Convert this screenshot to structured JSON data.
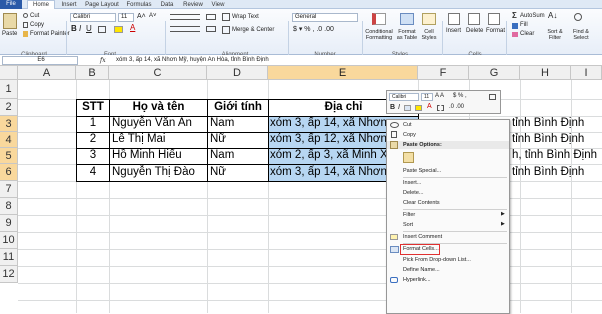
{
  "tabs": [
    "File",
    "Home",
    "Insert",
    "Page Layout",
    "Formulas",
    "Data",
    "Review",
    "View"
  ],
  "clipboard": {
    "cut": "Cut",
    "copy": "Copy",
    "format_painter": "Format Painter",
    "paste": "Paste",
    "group": "Clipboard"
  },
  "font": {
    "name": "Calibri",
    "size": "11",
    "group": "Font"
  },
  "alignment": {
    "wrap": "Wrap Text",
    "merge": "Merge & Center",
    "group": "Alignment"
  },
  "number": {
    "format": "General",
    "group": "Number"
  },
  "styles": {
    "cond": "Conditional Formatting",
    "fmt_table": "Format as Table",
    "cell_styles": "Cell Styles",
    "group": "Styles"
  },
  "cells": {
    "insert": "Insert",
    "delete": "Delete",
    "format": "Format",
    "group": "Cells"
  },
  "editing": {
    "autosum": "AutoSum",
    "fill": "Fill",
    "clear": "Clear",
    "sort": "Sort & Filter",
    "find": "Find & Select"
  },
  "formula_bar": {
    "name_box": "E6",
    "fx": "fx",
    "content": "xóm 3, ấp 14, xã Nhơn Mỹ, huyện An Hòa, tỉnh Bình Định"
  },
  "columns": [
    "A",
    "B",
    "C",
    "D",
    "E",
    "F",
    "G",
    "H",
    "I"
  ],
  "rows": [
    "1",
    "2",
    "3",
    "4",
    "5",
    "6",
    "7",
    "8",
    "9",
    "10",
    "11",
    "12"
  ],
  "table": {
    "headers": [
      "STT",
      "Họ và tên",
      "Giới tính",
      "Địa chỉ"
    ],
    "rows": [
      [
        "1",
        "Nguyễn Văn An",
        "Nam",
        "xóm 3, ấp 14, xã Nhơn M"
      ],
      [
        "2",
        "Lê Thị Mai",
        "Nữ",
        "xóm 3, ấp 12, xã Nhơn M"
      ],
      [
        "3",
        "Hồ Minh Hiếu",
        "Nam",
        "xóm 2, ấp 3, xã Minh Xu"
      ],
      [
        "4",
        "Nguyễn Thị Đào",
        "Nữ",
        "xóm 3, ấp 14, xã Nhơn M"
      ]
    ],
    "overflow": [
      "tỉnh Bình Định",
      "tỉnh Bình Định",
      "h, tỉnh Bình Định",
      "tỉnh Bình Định"
    ]
  },
  "mini_toolbar": {
    "font": "Calibri",
    "size": "11"
  },
  "context_menu": [
    "Cut",
    "Copy",
    "Paste Options:",
    "Paste Special...",
    "Insert...",
    "Delete...",
    "Clear Contents",
    "Filter",
    "Sort",
    "Insert Comment",
    "Format Cells...",
    "Pick From Drop-down List...",
    "Define Name...",
    "Hyperlink..."
  ],
  "colors": {
    "selection": "#b7d6f2",
    "header_sel": "#f9d89c",
    "highlight_box": "#e03030",
    "ribbon_tab": "#2a5aa8"
  }
}
